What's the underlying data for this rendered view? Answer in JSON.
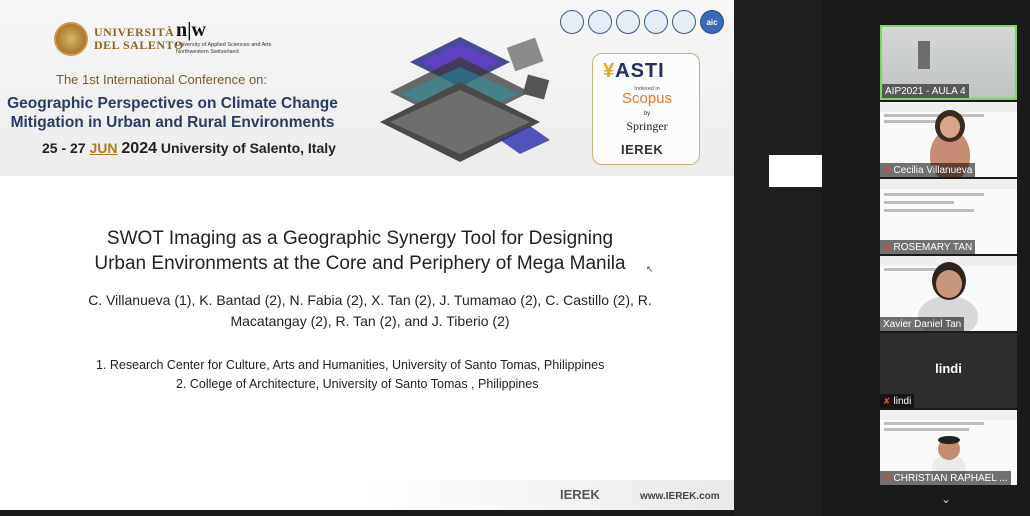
{
  "slide": {
    "university": {
      "line1": "UNIVERSITÀ",
      "line2": "DEL SALENTO"
    },
    "nw": {
      "mark": "n|w",
      "text": "University of Applied Sciences and Arts Northwestern Switzerland"
    },
    "conference": {
      "superscript_line": "The 1st International Conference on:",
      "title_line1": "Geographic Perspectives on Climate Change",
      "title_line2": "Mitigation in Urban and Rural Environments",
      "date": "25 - 27",
      "month": "JUN",
      "year": "2024",
      "venue": "University of Salento, Italy"
    },
    "partners": [
      "cnr-icon",
      "cmcc-icon",
      "partner-3-icon",
      "partner-4-icon",
      "partner-5-icon"
    ],
    "aic_label": "aic",
    "indexing": {
      "asti": "ASTI",
      "indexed_in": "Indexed in",
      "scopus": "Scopus",
      "by": "by",
      "springer": "Springer",
      "ierek": "IEREK"
    },
    "paper_title_line1": "SWOT Imaging as a Geographic Synergy Tool for Designing",
    "paper_title_line2": "Urban Environments at the Core and Periphery of Mega Manila",
    "authors_line1": "C. Villanueva (1),  K. Bantad (2), N. Fabia (2),  X. Tan (2), J. Tumamao (2), C. Castillo (2), R.",
    "authors_line2": "Macatangay (2), R. Tan (2), and J. Tiberio (2)",
    "affiliation1": "1. Research Center for Culture, Arts and Humanities, University of Santo Tomas, Philippines",
    "affiliation2": "2. College of Architecture, University of Santo Tomas , Philippines",
    "footer_logo": "IEREK",
    "footer_url": "www.IEREK.com"
  },
  "participants": [
    {
      "name": "AIP2021 - AULA 4",
      "muted": false,
      "active": true
    },
    {
      "name": "Cecilia Villanueva",
      "muted": true
    },
    {
      "name": "ROSEMARY TAN",
      "muted": true
    },
    {
      "name": "Xavier Daniel Tan",
      "muted": false
    },
    {
      "name": "lindi",
      "muted": true,
      "avatar_text": "lindi"
    },
    {
      "name": "CHRISTIAN RAPHAEL ...",
      "muted": true
    }
  ],
  "colors": {
    "active_border": "#7fd36a",
    "muted_icon": "#e2463b",
    "conference_title": "#2b3a67",
    "accent_gold": "#b07a20"
  }
}
